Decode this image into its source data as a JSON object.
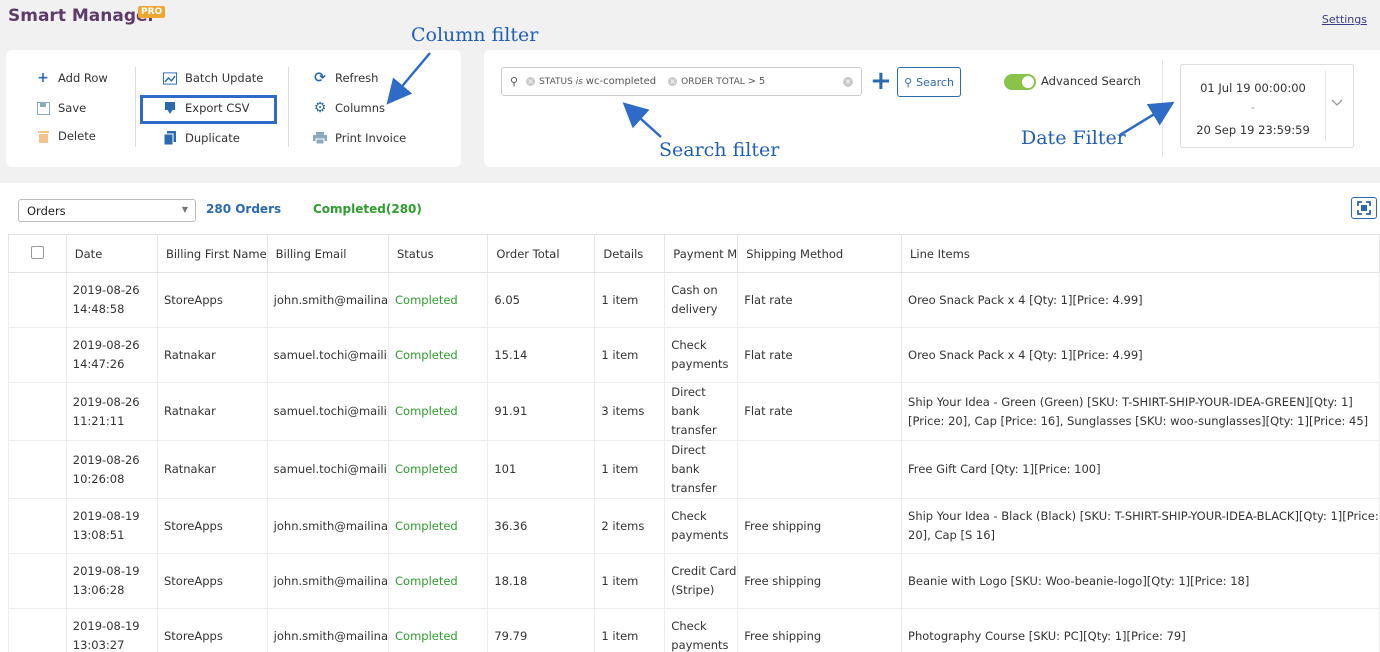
{
  "header": {
    "title": "Smart Manager",
    "badge": "PRO",
    "settings": "Settings"
  },
  "toolbar": {
    "add_row": "Add Row",
    "save": "Save",
    "delete": "Delete",
    "batch_update": "Batch Update",
    "export_csv": "Export CSV",
    "duplicate": "Duplicate",
    "refresh": "Refresh",
    "columns": "Columns",
    "print_invoice": "Print Invoice"
  },
  "search": {
    "chip1_field": "STATUS",
    "chip1_op": "is",
    "chip1_value": "wc-completed",
    "chip2_field": "ORDER TOTAL",
    "chip2_op": ">",
    "chip2_value": "5",
    "button": "Search",
    "advanced_label": "Advanced Search"
  },
  "date_filter": {
    "from": "01 Jul 19 00:00:00",
    "dash": "-",
    "to": "20 Sep 19 23:59:59"
  },
  "annotations": {
    "column_filter": "Column filter",
    "search_filter": "Search filter",
    "date_filter": "Date Filter"
  },
  "table_controls": {
    "dashboard": "Orders",
    "total_count": "280 Orders",
    "completed_count": "Completed(280)"
  },
  "columns": [
    "Date",
    "Billing First Name",
    "Billing Email",
    "Status",
    "Order Total",
    "Details",
    "Payment M",
    "Shipping Method",
    "Line Items"
  ],
  "rows": [
    {
      "date": "2019-08-26",
      "time": "14:48:58",
      "first_name": "StoreApps",
      "email": "john.smith@mailina",
      "status": "Completed",
      "total": "6.05",
      "details": "1 item",
      "payment": "Cash on delivery",
      "shipping": "Flat rate",
      "line_items": "Oreo Snack Pack x 4 [Qty: 1][Price: 4.99]"
    },
    {
      "date": "2019-08-26",
      "time": "14:47:26",
      "first_name": "Ratnakar",
      "email": "samuel.tochi@maili",
      "status": "Completed",
      "total": "15.14",
      "details": "1 item",
      "payment": "Check payments",
      "shipping": "Flat rate",
      "line_items": "Oreo Snack Pack x 4 [Qty: 1][Price: 4.99]"
    },
    {
      "date": "2019-08-26",
      "time": "11:21:11",
      "first_name": "Ratnakar",
      "email": "samuel.tochi@maili",
      "status": "Completed",
      "total": "91.91",
      "details": "3 items",
      "payment": "Direct bank transfer",
      "shipping": "Flat rate",
      "line_items": "Ship Your Idea - Green (Green) [SKU: T-SHIRT-SHIP-YOUR-IDEA-GREEN][Qty: 1][Price: 20], Cap [Price: 16], Sunglasses [SKU: woo-sunglasses][Qty: 1][Price: 45]"
    },
    {
      "date": "2019-08-26",
      "time": "10:26:08",
      "first_name": "Ratnakar",
      "email": "samuel.tochi@maili",
      "status": "Completed",
      "total": "101",
      "details": "1 item",
      "payment": "Direct bank transfer",
      "shipping": "",
      "line_items": "Free Gift Card [Qty: 1][Price: 100]"
    },
    {
      "date": "2019-08-19",
      "time": "13:08:51",
      "first_name": "StoreApps",
      "email": "john.smith@mailina",
      "status": "Completed",
      "total": "36.36",
      "details": "2 items",
      "payment": "Check payments",
      "shipping": "Free shipping",
      "line_items": "Ship Your Idea - Black (Black) [SKU: T-SHIRT-SHIP-YOUR-IDEA-BLACK][Qty: 1][Price: 20], Cap [S 16]"
    },
    {
      "date": "2019-08-19",
      "time": "13:06:28",
      "first_name": "StoreApps",
      "email": "john.smith@mailina",
      "status": "Completed",
      "total": "18.18",
      "details": "1 item",
      "payment": "Credit Card (Stripe)",
      "shipping": "Free shipping",
      "line_items": "Beanie with Logo [SKU: Woo-beanie-logo][Qty: 1][Price: 18]"
    },
    {
      "date": "2019-08-19",
      "time": "13:03:27",
      "first_name": "StoreApps",
      "email": "john.smith@mailina",
      "status": "Completed",
      "total": "79.79",
      "details": "1 item",
      "payment": "Check payments",
      "shipping": "Free shipping",
      "line_items": "Photography Course [SKU: PC][Qty: 1][Price: 79]"
    }
  ],
  "colors": {
    "brand": "#5e3b6b",
    "accent": "#2a6ab0",
    "status_green": "#2e9e2e",
    "annotation": "#2060b8",
    "toggle_on": "#8bc34a"
  }
}
